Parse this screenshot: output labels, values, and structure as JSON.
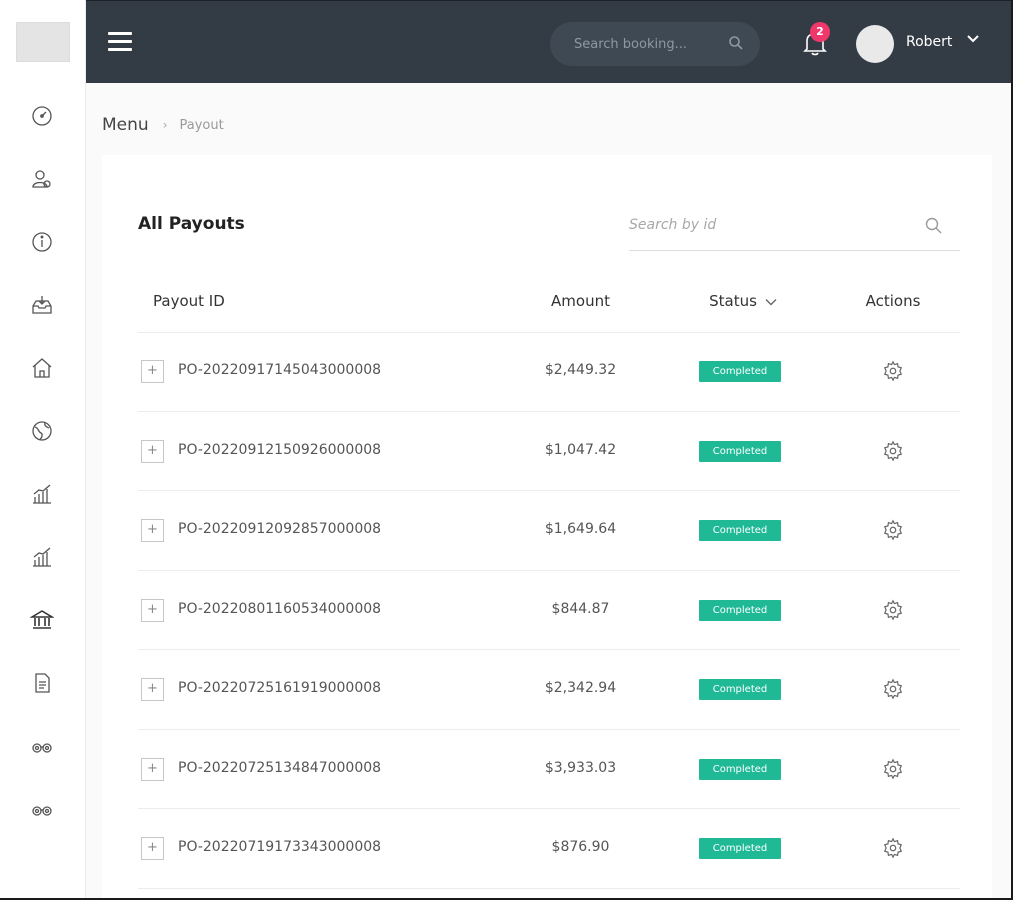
{
  "sidebar": {
    "items": [
      {
        "icon": "dashboard-icon"
      },
      {
        "icon": "users-icon"
      },
      {
        "icon": "info-icon"
      },
      {
        "icon": "inbox-download-icon"
      },
      {
        "icon": "home-icon"
      },
      {
        "icon": "globe-icon"
      },
      {
        "icon": "bar-chart-icon"
      },
      {
        "icon": "bar-chart-icon"
      },
      {
        "icon": "bank-icon"
      },
      {
        "icon": "document-icon"
      },
      {
        "icon": "binoculars-icon"
      },
      {
        "icon": "binoculars-icon"
      }
    ]
  },
  "topbar": {
    "search_placeholder": "Search booking...",
    "notification_count": "2",
    "user_name": "Robert"
  },
  "breadcrumb": {
    "root": "Menu",
    "separator": "›",
    "current": "Payout"
  },
  "card": {
    "title": "All Payouts",
    "search_placeholder": "Search by id"
  },
  "table": {
    "headers": {
      "id": "Payout ID",
      "amount": "Amount",
      "status": "Status",
      "actions": "Actions"
    },
    "rows": [
      {
        "id": "PO-20220917145043000008",
        "amount": "$2,449.32",
        "status": "Completed"
      },
      {
        "id": "PO-20220912150926000008",
        "amount": "$1,047.42",
        "status": "Completed"
      },
      {
        "id": "PO-20220912092857000008",
        "amount": "$1,649.64",
        "status": "Completed"
      },
      {
        "id": "PO-20220801160534000008",
        "amount": "$844.87",
        "status": "Completed"
      },
      {
        "id": "PO-20220725161919000008",
        "amount": "$2,342.94",
        "status": "Completed"
      },
      {
        "id": "PO-20220725134847000008",
        "amount": "$3,933.03",
        "status": "Completed"
      },
      {
        "id": "PO-20220719173343000008",
        "amount": "$876.90",
        "status": "Completed"
      }
    ]
  },
  "colors": {
    "topbar": "#333c45",
    "status_completed": "#1fb996",
    "badge": "#f0376b"
  }
}
